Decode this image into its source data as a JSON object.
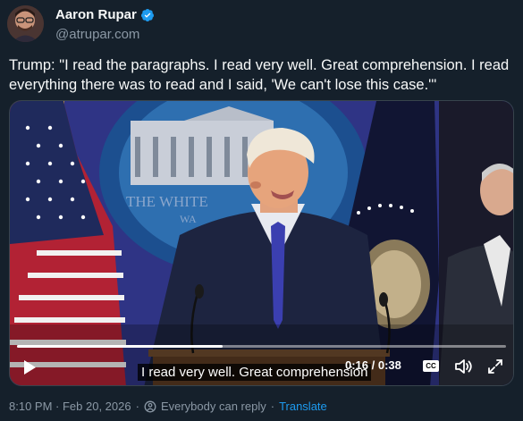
{
  "author": {
    "display_name": "Aaron Rupar",
    "handle": "@atrupar.com",
    "verified_icon": "verified-badge-icon"
  },
  "tweet": {
    "text": "Trump: \"I read the paragraphs. I read very well. Great comprehension. I read everything there was to read and I said, 'We can't lose this case.'\""
  },
  "video": {
    "caption": "I read very well. Great comprehension",
    "current_time": "0:16",
    "duration": "0:38",
    "time_display": "0:16 / 0:38",
    "progress_fraction": 0.42,
    "cc_label": "CC",
    "backdrop_text_1": "THE WHITE",
    "backdrop_text_2": "WA"
  },
  "footer": {
    "timestamp": "8:10 PM · Feb 20, 2026",
    "reply_setting": "Everybody can reply",
    "separator": "·",
    "translate": "Translate"
  },
  "colors": {
    "background": "#15202b",
    "text": "#f7f9f9",
    "secondary": "#8b98a5",
    "accent": "#1d9bf0"
  }
}
